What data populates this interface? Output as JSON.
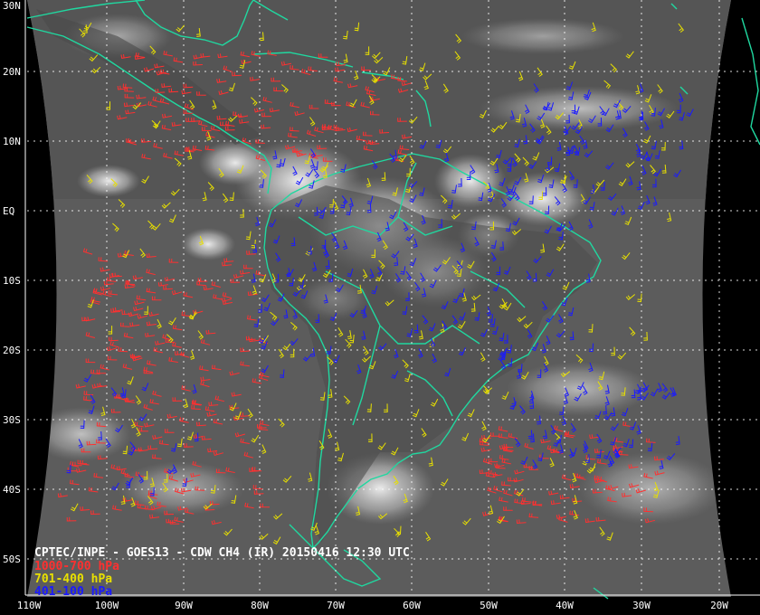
{
  "caption": "CPTEC/INPE - GOES13 - CDW CH4 (IR) 20150416 12:30 UTC",
  "legend": [
    {
      "label": "1000-700 hPa",
      "color": "#ff3030"
    },
    {
      "label": "701-400 hPa",
      "color": "#e8e000"
    },
    {
      "label": "401-100 hPa",
      "color": "#1a1aff"
    }
  ],
  "lat_labels": [
    "30N",
    "20N",
    "10N",
    "EQ",
    "10S",
    "20S",
    "30S",
    "40S",
    "50S"
  ],
  "lon_labels": [
    "110W",
    "100W",
    "90W",
    "80W",
    "70W",
    "60W",
    "50W",
    "40W",
    "30W",
    "20W"
  ],
  "colors": {
    "coastline": "#20d8a0",
    "grid": "#ffffff",
    "background": "#000000"
  }
}
